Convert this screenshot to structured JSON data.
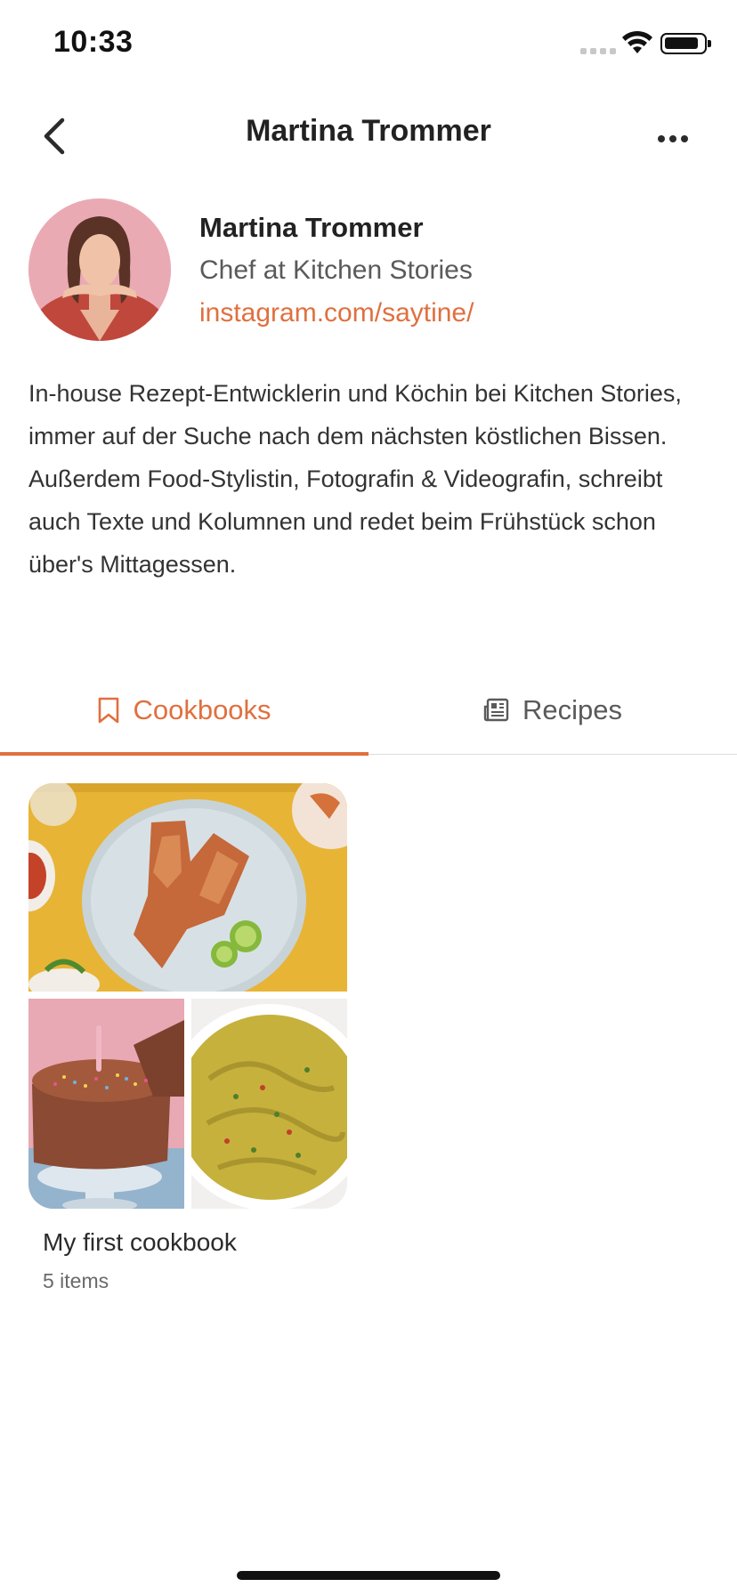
{
  "status_bar": {
    "time": "10:33"
  },
  "nav": {
    "title": "Martina Trommer"
  },
  "profile": {
    "name": "Martina Trommer",
    "role": "Chef at Kitchen Stories",
    "link": "instagram.com/saytine/",
    "bio": "In-house Rezept-Entwicklerin und Köchin bei Kitchen Stories, immer auf der Suche nach dem nächsten köstlichen Bissen. Außerdem Food-Stylistin, Fotografin & Videografin, schreibt auch Texte und Kolumnen und redet beim Frühstück schon über's Mittagessen."
  },
  "tabs": [
    {
      "label": "Cookbooks",
      "icon": "bookmark-icon",
      "active": true
    },
    {
      "label": "Recipes",
      "icon": "newspaper-icon",
      "active": false
    }
  ],
  "cookbooks": [
    {
      "title": "My first cookbook",
      "count": "5 items"
    }
  ],
  "colors": {
    "accent": "#e0703f",
    "text": "#2b2b2b",
    "muted": "#6a6a6a",
    "divider": "#dcdcdc"
  }
}
